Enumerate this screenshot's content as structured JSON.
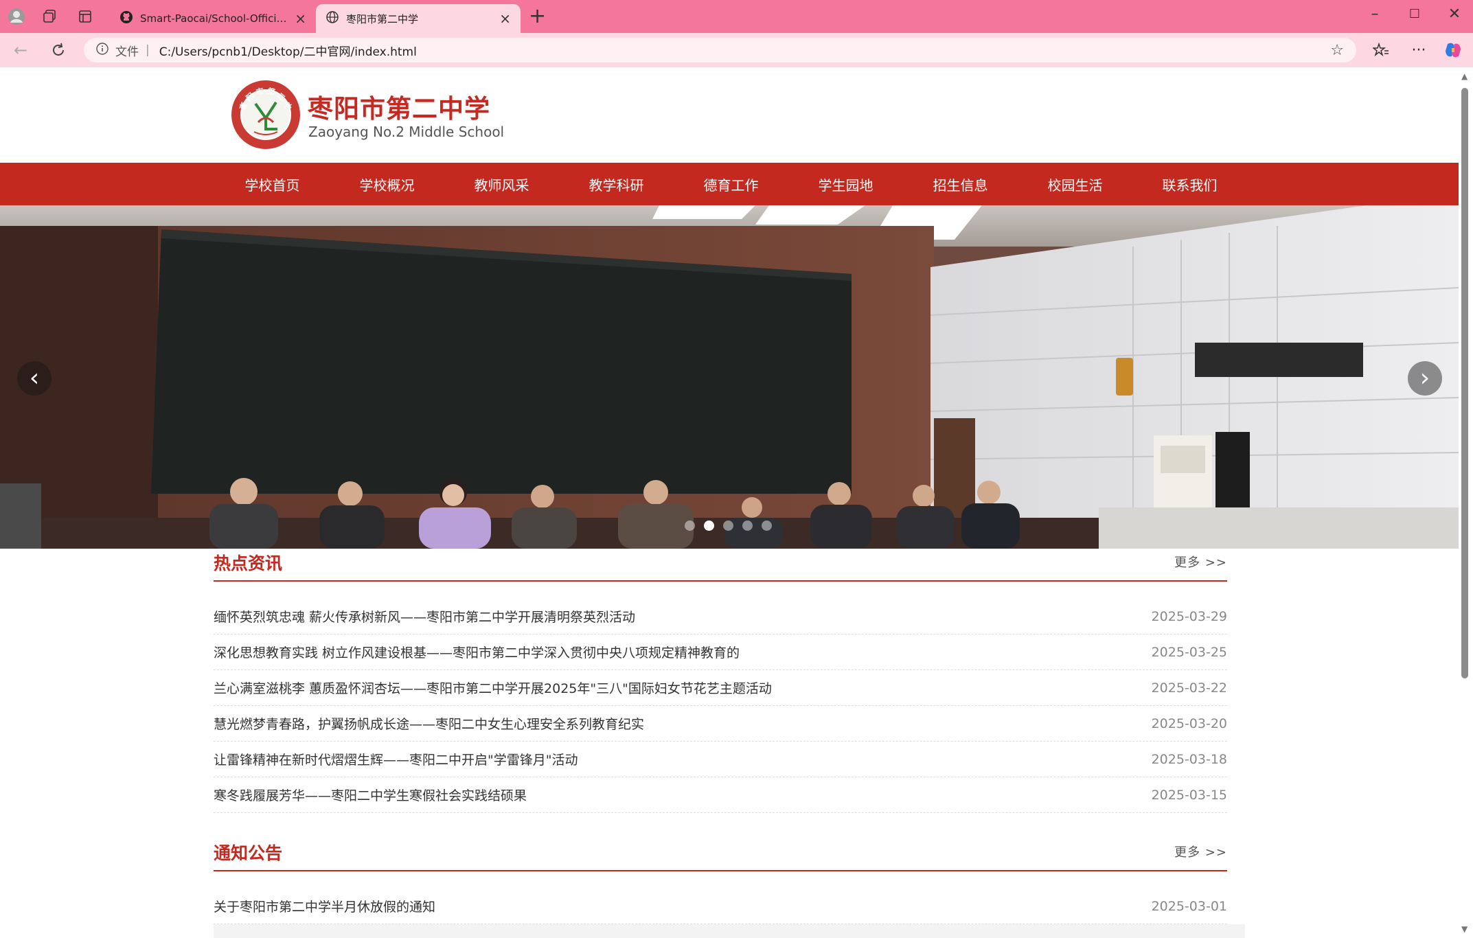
{
  "browser": {
    "tabs": [
      {
        "title": "Smart-Paocai/School-Official-Wel",
        "icon": "github-icon",
        "active": false
      },
      {
        "title": "枣阳市第二中学",
        "icon": "globe-icon",
        "active": true
      }
    ],
    "address": {
      "file_label": "文件",
      "url": "C:/Users/pcnb1/Desktop/二中官网/index.html"
    },
    "theme_color": "#f4769a"
  },
  "site": {
    "name": "枣阳市第二中学",
    "name_en": "Zaoyang No.2 Middle School",
    "logo_text": "枣阳市第二中学",
    "brand_color": "#c3291f"
  },
  "nav": {
    "items": [
      "学校首页",
      "学校概况",
      "教师风采",
      "教学科研",
      "德育工作",
      "学生园地",
      "招生信息",
      "校园生活",
      "联系我们"
    ]
  },
  "banner": {
    "prev_label": "‹",
    "next_label": "›",
    "slide_count": 5,
    "active_slide": 2
  },
  "hot_news": {
    "title": "热点资讯",
    "more": "更多 >>",
    "items": [
      {
        "title": "缅怀英烈筑忠魂 薪火传承树新风——枣阳市第二中学开展清明祭英烈活动",
        "date": "2025-03-29"
      },
      {
        "title": "深化思想教育实践 树立作风建设根基——枣阳市第二中学深入贯彻中央八项规定精神教育的",
        "date": "2025-03-25"
      },
      {
        "title": "兰心满室滋桃李 蕙质盈怀润杏坛——枣阳市第二中学开展2025年\"三八\"国际妇女节花艺主题活动",
        "date": "2025-03-22"
      },
      {
        "title": "慧光燃梦青春路，护翼扬帆成长途——枣阳二中女生心理安全系列教育纪实",
        "date": "2025-03-20"
      },
      {
        "title": "让雷锋精神在新时代熠熠生辉——枣阳二中开启\"学雷锋月\"活动",
        "date": "2025-03-18"
      },
      {
        "title": "寒冬践履展芳华——枣阳二中学生寒假社会实践结硕果",
        "date": "2025-03-15"
      }
    ]
  },
  "notices": {
    "title": "通知公告",
    "more": "更多 >>",
    "items": [
      {
        "title": "关于枣阳市第二中学半月休放假的通知",
        "date": "2025-03-01"
      }
    ]
  }
}
